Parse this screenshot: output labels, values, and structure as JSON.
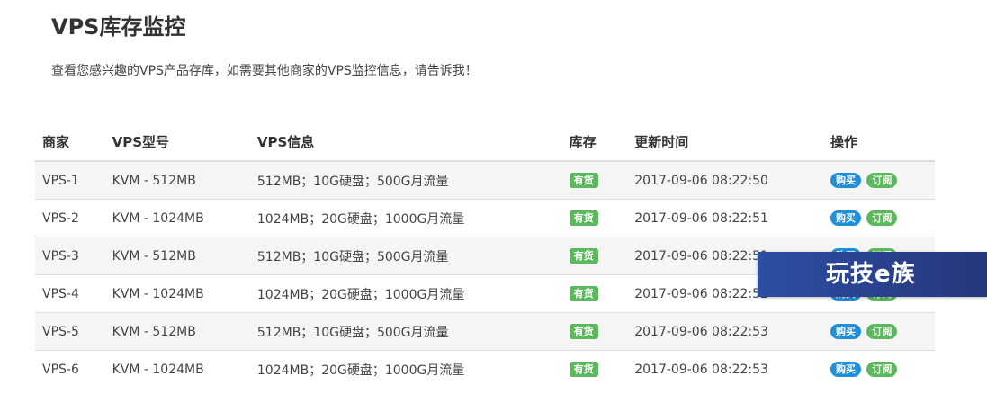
{
  "page": {
    "title": "VPS库存监控",
    "subtitle": "查看您感兴趣的VPS产品存库，如需要其他商家的VPS监控信息，请告诉我！"
  },
  "table": {
    "headers": [
      "商家",
      "VPS型号",
      "VPS信息",
      "库存",
      "更新时间",
      "操作"
    ],
    "rows": [
      {
        "vendor": "VPS-1",
        "model": "KVM - 512MB",
        "info": "512MB；10G硬盘；500G月流量",
        "stock": "有货",
        "time": "2017-09-06 08:22:50",
        "buy": "购买",
        "subscribe": "订阅"
      },
      {
        "vendor": "VPS-2",
        "model": "KVM - 1024MB",
        "info": "1024MB；20G硬盘；1000G月流量",
        "stock": "有货",
        "time": "2017-09-06 08:22:51",
        "buy": "购买",
        "subscribe": "订阅"
      },
      {
        "vendor": "VPS-3",
        "model": "KVM - 512MB",
        "info": "512MB；10G硬盘；500G月流量",
        "stock": "有货",
        "time": "2017-09-06 08:22:51",
        "buy": "购买",
        "subscribe": "订阅"
      },
      {
        "vendor": "VPS-4",
        "model": "KVM - 1024MB",
        "info": "1024MB；20G硬盘；1000G月流量",
        "stock": "有货",
        "time": "2017-09-06 08:22:52",
        "buy": "购买",
        "subscribe": "订阅"
      },
      {
        "vendor": "VPS-5",
        "model": "KVM - 512MB",
        "info": "512MB；10G硬盘；500G月流量",
        "stock": "有货",
        "time": "2017-09-06 08:22:53",
        "buy": "购买",
        "subscribe": "订阅"
      },
      {
        "vendor": "VPS-6",
        "model": "KVM - 1024MB",
        "info": "1024MB；20G硬盘；1000G月流量",
        "stock": "有货",
        "time": "2017-09-06 08:22:53",
        "buy": "购买",
        "subscribe": "订阅"
      }
    ]
  },
  "watermark": {
    "text": "玩技e族"
  },
  "colors": {
    "stock_label": "#5cb85c",
    "buy_badge": "#1e8fd8",
    "subscribe_badge": "#5cb85c",
    "stripe": "#f5f5f5",
    "watermark_bg": "#2d4ea2"
  }
}
